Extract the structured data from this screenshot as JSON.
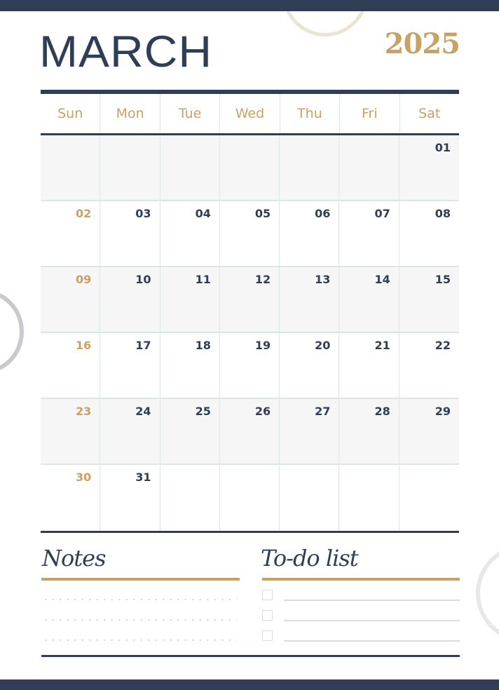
{
  "header": {
    "month": "MARCH",
    "year": "2025"
  },
  "colors": {
    "navy": "#2f3e55",
    "gold": "#c8a165",
    "grid_line": "#dce9df",
    "shaded_row": "#f6f6f6"
  },
  "weekdays": [
    "Sun",
    "Mon",
    "Tue",
    "Wed",
    "Thu",
    "Fri",
    "Sat"
  ],
  "weeks": [
    [
      "",
      "",
      "",
      "",
      "",
      "",
      "01"
    ],
    [
      "02",
      "03",
      "04",
      "05",
      "06",
      "07",
      "08"
    ],
    [
      "09",
      "10",
      "11",
      "12",
      "13",
      "14",
      "15"
    ],
    [
      "16",
      "17",
      "18",
      "19",
      "20",
      "21",
      "22"
    ],
    [
      "23",
      "24",
      "25",
      "26",
      "27",
      "28",
      "29"
    ],
    [
      "30",
      "31",
      "",
      "",
      "",
      "",
      ""
    ]
  ],
  "notes": {
    "title": "Notes",
    "line_count": 3
  },
  "todo": {
    "title": "To-do list",
    "items": [
      {
        "checked": false,
        "text": ""
      },
      {
        "checked": false,
        "text": ""
      },
      {
        "checked": false,
        "text": ""
      }
    ]
  }
}
